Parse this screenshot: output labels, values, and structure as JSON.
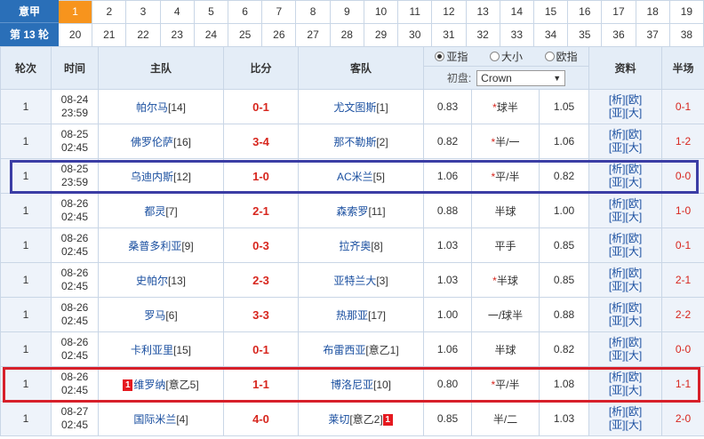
{
  "league": {
    "name": "意甲",
    "round_label": "第 13 轮"
  },
  "rounds": {
    "row1": [
      "1",
      "2",
      "3",
      "4",
      "5",
      "6",
      "7",
      "8",
      "9",
      "10",
      "11",
      "12",
      "13",
      "14",
      "15",
      "16",
      "17",
      "18",
      "19"
    ],
    "row2": [
      "20",
      "21",
      "22",
      "23",
      "24",
      "25",
      "26",
      "27",
      "28",
      "29",
      "30",
      "31",
      "32",
      "33",
      "34",
      "35",
      "36",
      "37",
      "38"
    ],
    "active": "1"
  },
  "headers": {
    "round": "轮次",
    "time": "时间",
    "home": "主队",
    "score": "比分",
    "away": "客队",
    "radio_asian": "亚指",
    "radio_ou": "大小",
    "radio_eu": "欧指",
    "initial_label": "初盘:",
    "company": "Crown",
    "info": "资料",
    "half": "半场"
  },
  "link_labels": {
    "line1": "[析][欧]",
    "line2": "[亚][大]"
  },
  "matches": [
    {
      "round": "1",
      "date": "08-24",
      "time": "23:59",
      "home": "帕尔马",
      "home_rank": "[14]",
      "score": "0-1",
      "away": "尤文图斯",
      "away_rank": "[1]",
      "o1": "0.83",
      "star": "*",
      "line": "球半",
      "o2": "1.05",
      "ht": "0-1"
    },
    {
      "round": "1",
      "date": "08-25",
      "time": "02:45",
      "home": "佛罗伦萨",
      "home_rank": "[16]",
      "score": "3-4",
      "away": "那不勒斯",
      "away_rank": "[2]",
      "o1": "0.82",
      "star": "*",
      "line": "半/一",
      "o2": "1.06",
      "ht": "1-2"
    },
    {
      "round": "1",
      "date": "08-25",
      "time": "23:59",
      "home": "乌迪内斯",
      "home_rank": "[12]",
      "score": "1-0",
      "away": "AC米兰",
      "away_rank": "[5]",
      "o1": "1.06",
      "star": "*",
      "line": "平/半",
      "o2": "0.82",
      "ht": "0-0"
    },
    {
      "round": "1",
      "date": "08-26",
      "time": "02:45",
      "home": "都灵",
      "home_rank": "[7]",
      "score": "2-1",
      "away": "森索罗",
      "away_rank": "[11]",
      "o1": "0.88",
      "star": "",
      "line": "半球",
      "o2": "1.00",
      "ht": "1-0"
    },
    {
      "round": "1",
      "date": "08-26",
      "time": "02:45",
      "home": "桑普多利亚",
      "home_rank": "[9]",
      "score": "0-3",
      "away": "拉齐奥",
      "away_rank": "[8]",
      "o1": "1.03",
      "star": "",
      "line": "平手",
      "o2": "0.85",
      "ht": "0-1"
    },
    {
      "round": "1",
      "date": "08-26",
      "time": "02:45",
      "home": "史帕尔",
      "home_rank": "[13]",
      "score": "2-3",
      "away": "亚特兰大",
      "away_rank": "[3]",
      "o1": "1.03",
      "star": "*",
      "line": "半球",
      "o2": "0.85",
      "ht": "2-1"
    },
    {
      "round": "1",
      "date": "08-26",
      "time": "02:45",
      "home": "罗马",
      "home_rank": "[6]",
      "score": "3-3",
      "away": "热那亚",
      "away_rank": "[17]",
      "o1": "1.00",
      "star": "",
      "line": "一/球半",
      "o2": "0.88",
      "ht": "2-2"
    },
    {
      "round": "1",
      "date": "08-26",
      "time": "02:45",
      "home": "卡利亚里",
      "home_rank": "[15]",
      "score": "0-1",
      "away": "布雷西亚",
      "away_rank": "[意乙1]",
      "o1": "1.06",
      "star": "",
      "line": "半球",
      "o2": "0.82",
      "ht": "0-0"
    },
    {
      "round": "1",
      "date": "08-26",
      "time": "02:45",
      "home_card": "1",
      "home": "维罗纳",
      "home_rank": "[意乙5]",
      "score": "1-1",
      "away": "博洛尼亚",
      "away_rank": "[10]",
      "o1": "0.80",
      "star": "*",
      "line": "平/半",
      "o2": "1.08",
      "ht": "1-1"
    },
    {
      "round": "1",
      "date": "08-27",
      "time": "02:45",
      "home": "国际米兰",
      "home_rank": "[4]",
      "score": "4-0",
      "away": "莱切",
      "away_rank": "[意乙2]",
      "away_card": "1",
      "o1": "0.85",
      "star": "",
      "line": "半/二",
      "o2": "1.03",
      "ht": "2-0"
    }
  ]
}
